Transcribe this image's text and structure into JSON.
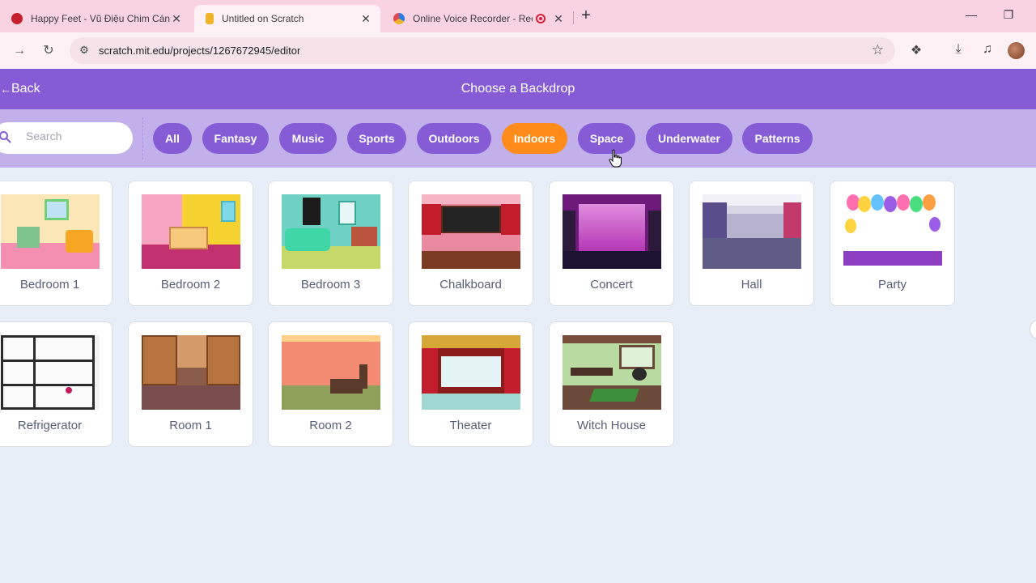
{
  "browser": {
    "tabs": [
      {
        "title": "Happy Feet - Vũ Điệu Chim Cánh",
        "favicon_color": "#c4202e",
        "close": "✕"
      },
      {
        "title": "Untitled on Scratch",
        "favicon_color": "#f0b429",
        "close": "✕"
      },
      {
        "title": "Online Voice Recorder - Rec",
        "favicon_color": "#2d7ee8",
        "close": "✕",
        "recording": true
      }
    ],
    "new_tab": "+",
    "url": "scratch.mit.edu/projects/1267672945/editor",
    "icons": [
      "forward-icon",
      "reload-icon",
      "site-info-icon",
      "bookmark-star-icon",
      "extensions-icon",
      "download-icon",
      "media-icon",
      "profile-avatar"
    ]
  },
  "header": {
    "back_label": "Back",
    "title": "Choose a Backdrop"
  },
  "search": {
    "placeholder": "Search"
  },
  "categories": [
    {
      "label": "All",
      "active": false
    },
    {
      "label": "Fantasy",
      "active": false
    },
    {
      "label": "Music",
      "active": false
    },
    {
      "label": "Sports",
      "active": false
    },
    {
      "label": "Outdoors",
      "active": false
    },
    {
      "label": "Indoors",
      "active": true
    },
    {
      "label": "Space",
      "active": false
    },
    {
      "label": "Underwater",
      "active": false
    },
    {
      "label": "Patterns",
      "active": false
    }
  ],
  "backdrops": [
    {
      "name": "Bedroom 1",
      "bg": "#fbe6b8"
    },
    {
      "name": "Bedroom 2",
      "bg": "#f7a5c2"
    },
    {
      "name": "Bedroom 3",
      "bg": "#6fd1c4"
    },
    {
      "name": "Chalkboard",
      "bg": "#e98aa0"
    },
    {
      "name": "Concert",
      "bg": "#6d1a7a"
    },
    {
      "name": "Hall",
      "bg": "#d8d5e6"
    },
    {
      "name": "Party",
      "bg": "#ffffff"
    },
    {
      "name": "Refrigerator",
      "bg": "#f3f3f3"
    },
    {
      "name": "Room 1",
      "bg": "#8c5c4a"
    },
    {
      "name": "Room 2",
      "bg": "#f28b72"
    },
    {
      "name": "Theater",
      "bg": "#8a1c1c"
    },
    {
      "name": "Witch House",
      "bg": "#b9dba0"
    }
  ],
  "colors": {
    "scratch_purple": "#855cd6",
    "filter_bar": "#c2b0ea",
    "active_orange": "#ff8c1a",
    "tab_bar_pink": "#fad3e2"
  }
}
